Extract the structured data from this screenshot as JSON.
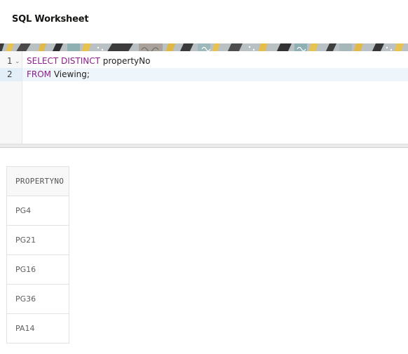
{
  "header": {
    "title": "SQL Worksheet"
  },
  "editor": {
    "lines": [
      {
        "number": "1",
        "keywords": "SELECT DISTINCT",
        "rest": " propertyNo"
      },
      {
        "number": "2",
        "keywords": "FROM",
        "rest": " Viewing;"
      }
    ],
    "fold_icon": "chevron-down-icon"
  },
  "results": {
    "column_header": "PROPERTYNO",
    "rows": [
      "PG4",
      "PG21",
      "PG16",
      "PG36",
      "PA14"
    ]
  },
  "colors": {
    "keyword": "#8b1f8e",
    "active_line": "#eff6fb",
    "banner_base": "#b9c1c4",
    "banner_accent": "#e8c24e"
  }
}
